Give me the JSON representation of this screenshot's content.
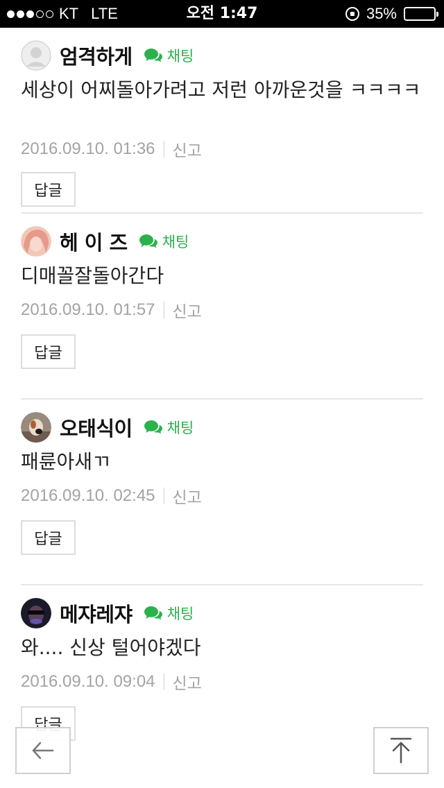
{
  "status_bar": {
    "carrier": "KT",
    "network": "LTE",
    "time": "오전 1:47",
    "battery_percent": "35%",
    "battery_level": 0.35,
    "signal_bars": 3
  },
  "chat_label": "채팅",
  "comments": [
    {
      "author": "엄격하게",
      "text": "세상이 어찌돌아가려고 저런 아까운것을 ㅋㅋㅋㅋ",
      "timestamp": "2016.09.10. 01:36",
      "report": "신고",
      "reply": "답글",
      "avatar": "default-avatar"
    },
    {
      "author": "헤 이 즈",
      "text": "디매꼴잘돌아간다",
      "timestamp": "2016.09.10. 01:57",
      "report": "신고",
      "reply": "답글",
      "avatar": "photo-avatar"
    },
    {
      "author": "오태식이",
      "text": "패륜아새ㄲ",
      "timestamp": "2016.09.10. 02:45",
      "report": "신고",
      "reply": "답글",
      "avatar": "photo-avatar"
    },
    {
      "author": "메쟈레쟈",
      "text": "와.... 신상 털어야겠다",
      "timestamp": "2016.09.10. 09:04",
      "report": "신고",
      "reply": "답글",
      "avatar": "photo-avatar"
    }
  ],
  "icons": {
    "back": "arrow-left-icon",
    "top": "arrow-up-to-top-icon",
    "chat": "speech-bubble-icon"
  },
  "colors": {
    "chat_green": "#2bb24c",
    "meta_gray": "#a3a3a3",
    "divider": "#e6e6e6"
  }
}
